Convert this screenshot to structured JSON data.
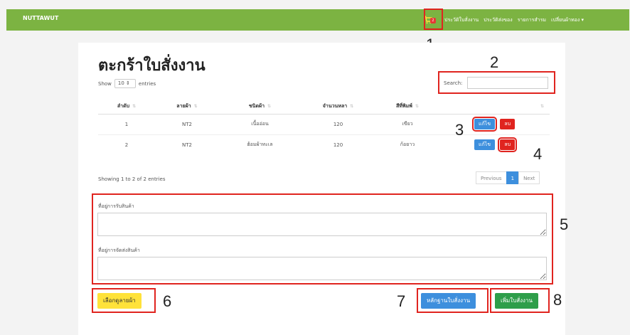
{
  "navbar": {
    "brand": "NUTTAWUT",
    "cart_count": "2",
    "links": [
      "ประวัติใบสั่งงาน",
      "ประวัติส่งของ",
      "รายการสำรม",
      "เปลี่ยนผ้าทอง"
    ]
  },
  "annotations": [
    "1",
    "2",
    "3",
    "4",
    "5",
    "6",
    "7",
    "8"
  ],
  "page": {
    "title": "ตะกร้าใบสั่งงาน",
    "show_label": "Show",
    "entries_value": "10",
    "entries_label": "entries",
    "search_label": "Search:",
    "search_value": ""
  },
  "table": {
    "headers": [
      "ลำดับ",
      "ลายผ้า",
      "ชนิดผ้า",
      "จำนวนหลา",
      "สีที่พิมพ์",
      ""
    ],
    "rows": [
      [
        "1",
        "NT2",
        "เนื้ออ่อน",
        "120",
        "เขียว"
      ],
      [
        "2",
        "NT2",
        "ฮ้อมผ้าทะเล",
        "120",
        "ก้อยาว"
      ]
    ],
    "edit_label": "แก้ไข",
    "delete_label": "ลบ"
  },
  "footer_info": "Showing 1 to 2 of 2 entries",
  "pagination": {
    "previous": "Previous",
    "current": "1",
    "next": "Next"
  },
  "form": {
    "receive_address_label": "ที่อยู่การรับสินค้า",
    "receive_address_value": "",
    "ship_address_label": "ที่อยู่การจัดส่งสินค้า",
    "ship_address_value": ""
  },
  "buttons": {
    "choose_pattern": "เลือกดูลายผ้า",
    "evidence": "หลักฐานใบสั่งงาน",
    "add_order": "เพิ่มใบสั่งงาน"
  },
  "colors": {
    "navbar": "#7cb342",
    "primary": "#3d8fdd",
    "danger": "#e0241f",
    "success": "#2e9e4a",
    "warning": "#ffe23a"
  }
}
